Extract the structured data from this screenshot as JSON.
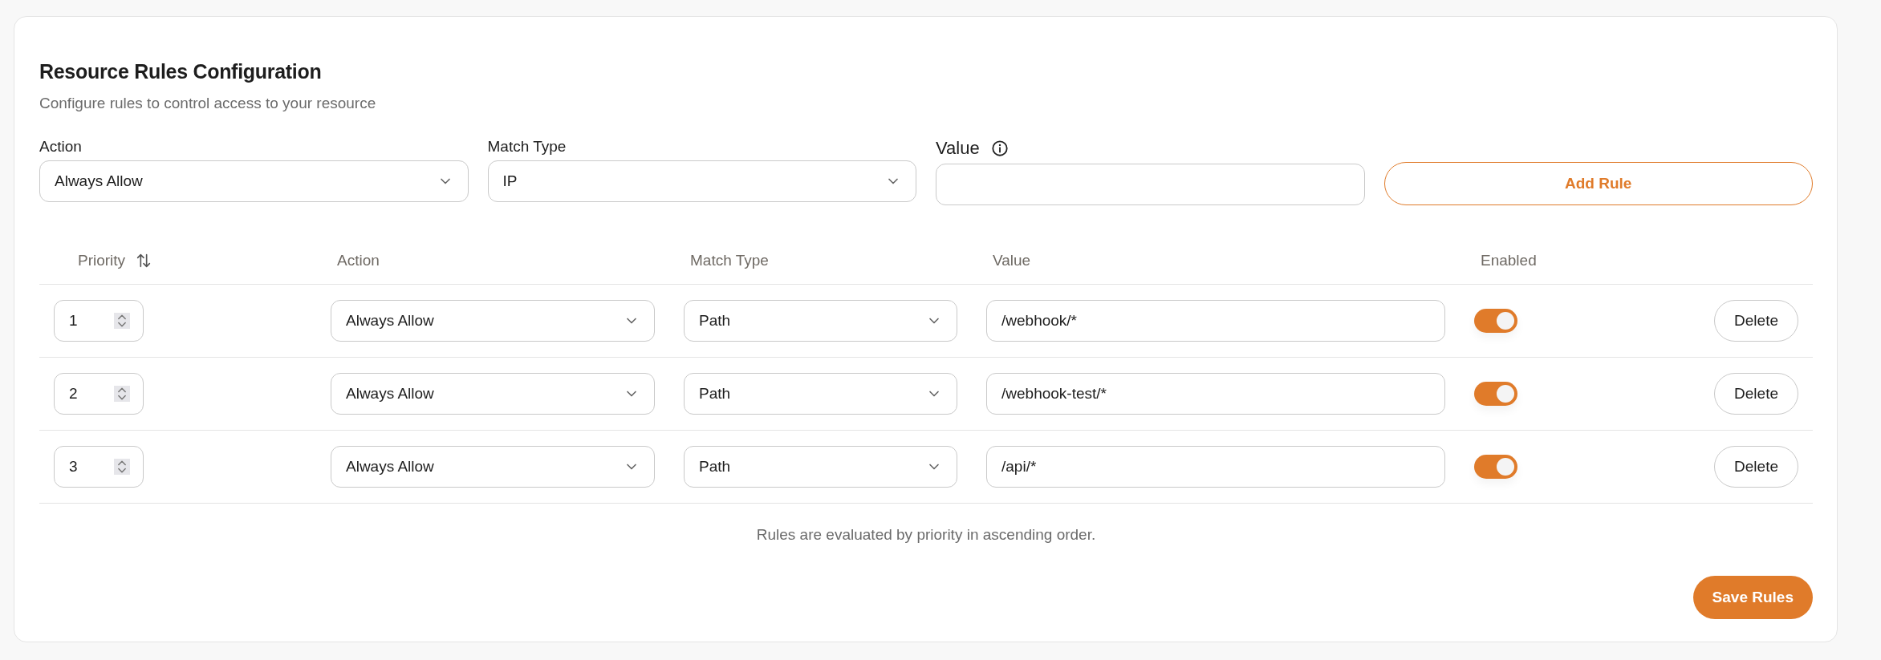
{
  "card": {
    "title": "Resource Rules Configuration",
    "subtitle": "Configure rules to control access to your resource"
  },
  "form": {
    "action": {
      "label": "Action",
      "value": "Always Allow"
    },
    "match_type": {
      "label": "Match Type",
      "value": "IP"
    },
    "value": {
      "label": "Value"
    },
    "add_button": "Add Rule"
  },
  "table": {
    "columns": [
      {
        "label": "Priority",
        "sortable": true
      },
      {
        "label": "Action",
        "sortable": false
      },
      {
        "label": "Match Type",
        "sortable": false
      },
      {
        "label": "Value",
        "sortable": false
      },
      {
        "label": "Enabled",
        "sortable": false
      }
    ],
    "rows": [
      {
        "priority": "1",
        "action": "Always Allow",
        "match_type": "Path",
        "value": "/webhook/*",
        "enabled": true,
        "delete": "Delete"
      },
      {
        "priority": "2",
        "action": "Always Allow",
        "match_type": "Path",
        "value": "/webhook-test/*",
        "enabled": true,
        "delete": "Delete"
      },
      {
        "priority": "3",
        "action": "Always Allow",
        "match_type": "Path",
        "value": "/api/*",
        "enabled": true,
        "delete": "Delete"
      }
    ]
  },
  "footnote": "Rules are evaluated by priority in ascending order.",
  "save_button": "Save Rules"
}
